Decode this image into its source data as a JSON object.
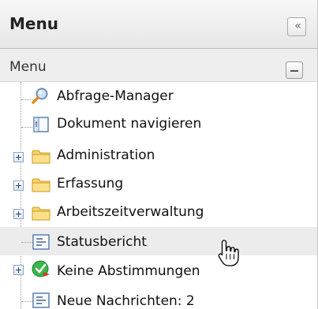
{
  "header": {
    "title": "Menu",
    "collapse_icon": "double-chevron-left-icon"
  },
  "subheader": {
    "title": "Menu",
    "collapse_icon": "minus-icon"
  },
  "tree": {
    "items": [
      {
        "label": "Abfrage-Manager",
        "icon": "magnifier-icon",
        "expandable": false
      },
      {
        "label": "Dokument navigieren",
        "icon": "document-navigator-icon",
        "expandable": false
      },
      {
        "label": "Administration",
        "icon": "folder-icon",
        "expandable": true
      },
      {
        "label": "Erfassung",
        "icon": "folder-icon",
        "expandable": true
      },
      {
        "label": "Arbeitszeitverwaltung",
        "icon": "folder-icon",
        "expandable": true
      },
      {
        "label": "Statusbericht",
        "icon": "report-icon",
        "expandable": false,
        "hovered": true
      },
      {
        "label": "Keine Abstimmungen",
        "icon": "green-check-icon",
        "expandable": true
      },
      {
        "label": "Neue Nachrichten: 2",
        "icon": "report-icon",
        "expandable": false
      }
    ]
  },
  "colors": {
    "header_bg": "#ececec",
    "hover_row": "#ececec",
    "folder": "#f5cf62",
    "check_green": "#3bb54a"
  }
}
